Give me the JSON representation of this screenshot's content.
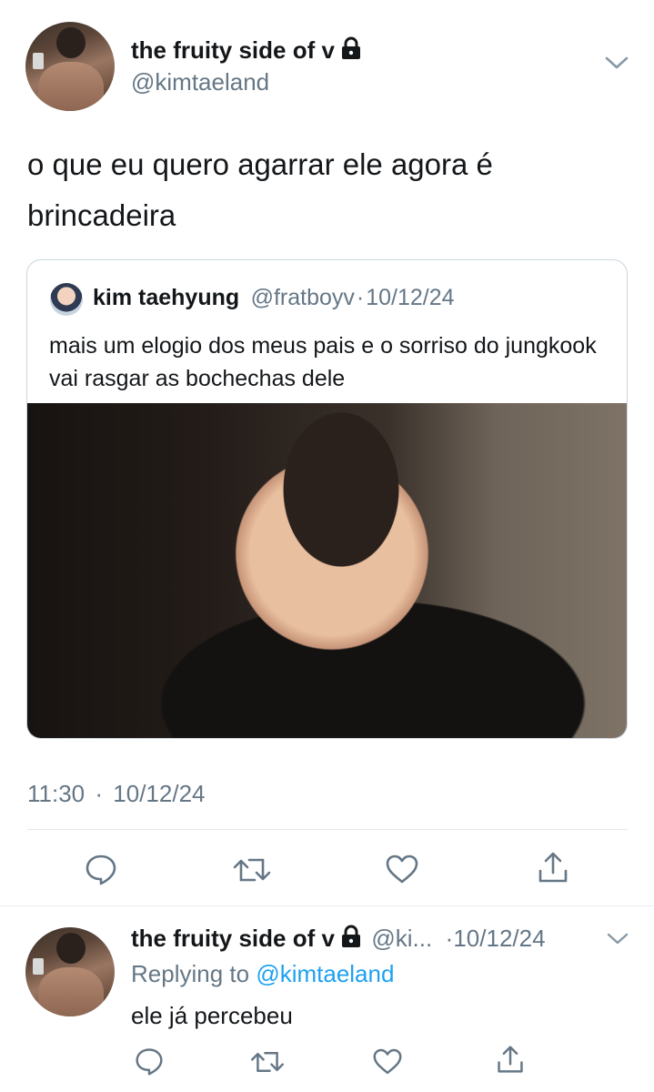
{
  "main_tweet": {
    "author_name": "the fruity side of v",
    "handle": "@kimtaeland",
    "text": "o que eu quero agarrar ele agora é brincadeira",
    "timestamp": "11:30",
    "date_sep": "·",
    "date": "10/12/24"
  },
  "quoted_tweet": {
    "author_name": "kim taehyung",
    "handle": "@fratboyv",
    "date_sep": "·",
    "date": "10/12/24",
    "text": "mais um elogio dos meus pais e o sorriso do jungkook vai rasgar as bochechas dele"
  },
  "actions": [
    "reply-icon",
    "retweet-icon",
    "like-icon",
    "share-icon"
  ],
  "reply_tweet": {
    "author_name": "the fruity side of v",
    "handle_truncated": "@ki...",
    "date_sep": "·",
    "date": "10/12/24",
    "replying_to_label": "Replying to",
    "replying_to_handle": "@kimtaeland",
    "text": "ele já percebeu"
  },
  "colors": {
    "text": "#14171a",
    "secondary": "#657786",
    "link": "#1da1f2",
    "border": "#ccd6dd"
  }
}
